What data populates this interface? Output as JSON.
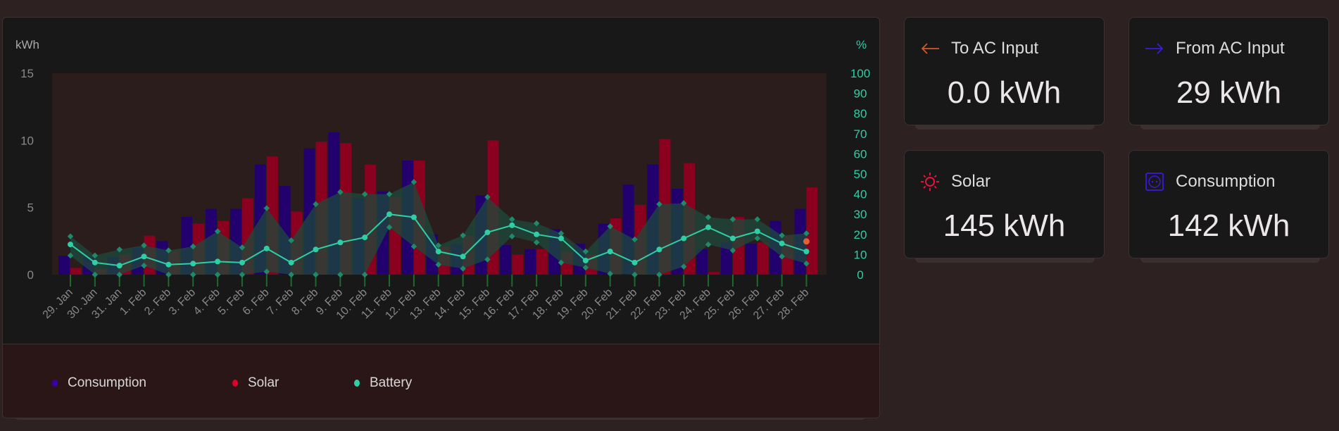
{
  "colors": {
    "consumption": "#22006e",
    "solar": "#8a001e",
    "battery": "#2ecfa4",
    "band": "#1e4a3c",
    "current": "#e0603a",
    "to_ac": "#d0582a",
    "from_ac": "#3c18e0",
    "solar_icon": "#ff1040",
    "consumption_icon": "#3c18e0"
  },
  "chart_data": {
    "type": "bar",
    "left_axis_label": "kWh",
    "right_axis_label": "%",
    "left_ticks": [
      "0",
      "5",
      "10",
      "15"
    ],
    "right_ticks": [
      "0",
      "10",
      "20",
      "30",
      "40",
      "50",
      "60",
      "70",
      "80",
      "90",
      "100"
    ],
    "ylim": [
      0,
      15
    ],
    "y2lim": [
      0,
      100
    ],
    "categories": [
      "29. Jan",
      "30. Jan",
      "31. Jan",
      "1. Feb",
      "2. Feb",
      "3. Feb",
      "4. Feb",
      "5. Feb",
      "6. Feb",
      "7. Feb",
      "8. Feb",
      "9. Feb",
      "10. Feb",
      "11. Feb",
      "12. Feb",
      "13. Feb",
      "14. Feb",
      "15. Feb",
      "16. Feb",
      "17. Feb",
      "18. Feb",
      "19. Feb",
      "20. Feb",
      "21. Feb",
      "22. Feb",
      "23. Feb",
      "24. Feb",
      "25. Feb",
      "26. Feb",
      "27. Feb",
      "28. Feb"
    ],
    "series": [
      {
        "name": "Consumption",
        "type": "bar",
        "axis": "kWh",
        "values": [
          1.4,
          1.3,
          1.3,
          2.0,
          2.5,
          4.3,
          4.9,
          4.9,
          8.2,
          6.6,
          9.4,
          10.6,
          5.7,
          6.2,
          8.5,
          3.0,
          2.3,
          5.9,
          2.2,
          1.9,
          3.4,
          2.3,
          3.8,
          6.7,
          8.2,
          6.4,
          1.9,
          2.4,
          2.3,
          4.0,
          4.9
        ]
      },
      {
        "name": "Solar",
        "type": "bar",
        "axis": "kWh",
        "values": [
          0.5,
          0.4,
          1.5,
          2.9,
          1.8,
          3.8,
          4.0,
          5.7,
          8.8,
          4.7,
          9.9,
          9.8,
          8.2,
          5.8,
          8.5,
          2.1,
          2.9,
          10.0,
          1.5,
          1.9,
          1.7,
          1.5,
          4.2,
          5.2,
          10.1,
          8.3,
          0.2,
          4.3,
          2.4,
          2.9,
          6.5
        ]
      },
      {
        "name": "Battery",
        "type": "line",
        "axis": "%",
        "values": [
          15,
          6,
          4.5,
          9,
          5,
          5.5,
          6.5,
          6,
          13,
          6,
          12.5,
          16,
          18.5,
          30,
          28.5,
          11.5,
          9,
          21,
          24.5,
          20,
          18,
          7,
          11.5,
          6,
          12.5,
          18,
          23.5,
          18,
          21.5,
          15.5,
          11.5
        ],
        "max": [
          19,
          9.5,
          12.5,
          14.5,
          12,
          14,
          21.5,
          13.5,
          33,
          17,
          35,
          41,
          40,
          40,
          46,
          14.5,
          19.5,
          38.5,
          27.5,
          25.5,
          20.5,
          11.5,
          24,
          17.5,
          35,
          35.5,
          28.5,
          27.5,
          27.5,
          19.5,
          20.5
        ],
        "min": [
          9.5,
          0,
          0,
          4.5,
          0,
          0,
          0,
          0,
          1.5,
          0,
          0,
          0,
          0,
          23.5,
          14,
          5,
          3,
          7.5,
          19,
          16,
          6,
          3.5,
          0.5,
          0,
          0,
          4,
          15,
          12,
          18,
          9,
          5.5
        ]
      }
    ],
    "current_battery": 16.5,
    "legend": [
      "Consumption",
      "Solar",
      "Battery"
    ],
    "legend_position": "bottom"
  },
  "cards": [
    {
      "title": "To AC Input",
      "value": "0.0 kWh",
      "icon": "arrow-left-icon"
    },
    {
      "title": "From AC Input",
      "value": "29 kWh",
      "icon": "arrow-right-icon"
    },
    {
      "title": "Solar",
      "value": "145 kWh",
      "icon": "sun-icon"
    },
    {
      "title": "Consumption",
      "value": "142 kWh",
      "icon": "socket-icon"
    }
  ]
}
